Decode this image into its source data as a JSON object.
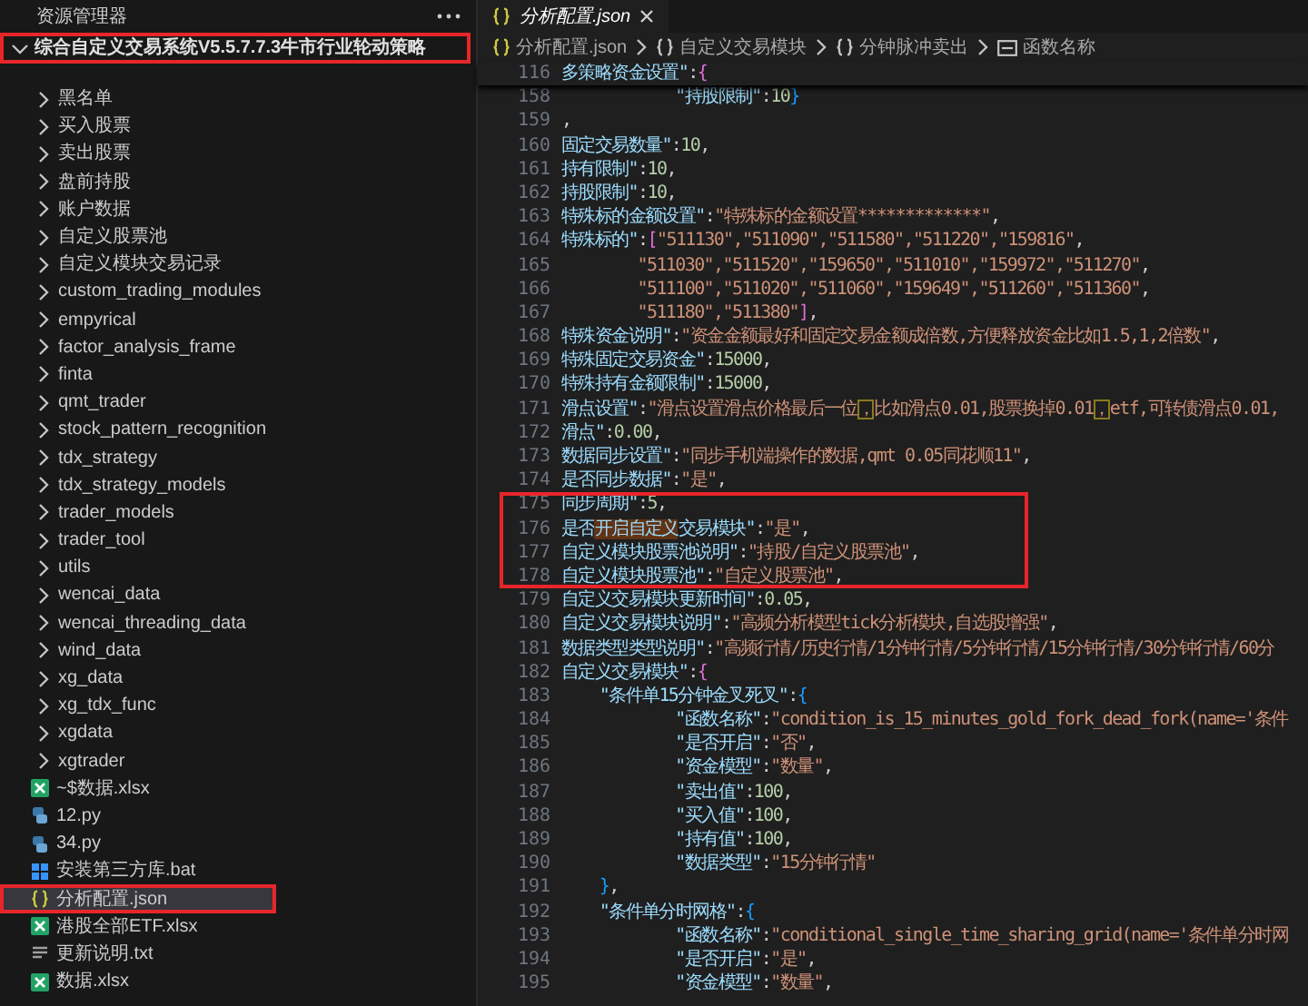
{
  "sidebar": {
    "title": "资源管理器",
    "root": {
      "label": "综合自定义交易系统V5.5.7.7.3牛市行业轮动策略",
      "expanded": true,
      "highlighted": true
    },
    "items": [
      {
        "kind": "folder",
        "label": "黑名单",
        "expanded": false,
        "selected": false,
        "highlighted": false
      },
      {
        "kind": "folder",
        "label": "买入股票",
        "expanded": false,
        "selected": false,
        "highlighted": false
      },
      {
        "kind": "folder",
        "label": "卖出股票",
        "expanded": false,
        "selected": false,
        "highlighted": false
      },
      {
        "kind": "folder",
        "label": "盘前持股",
        "expanded": false,
        "selected": false,
        "highlighted": false
      },
      {
        "kind": "folder",
        "label": "账户数据",
        "expanded": false,
        "selected": false,
        "highlighted": false
      },
      {
        "kind": "folder",
        "label": "自定义股票池",
        "expanded": false,
        "selected": false,
        "highlighted": false
      },
      {
        "kind": "folder",
        "label": "自定义模块交易记录",
        "expanded": false,
        "selected": false,
        "highlighted": false
      },
      {
        "kind": "folder",
        "label": "custom_trading_modules",
        "expanded": false,
        "selected": false,
        "highlighted": false
      },
      {
        "kind": "folder",
        "label": "empyrical",
        "expanded": false,
        "selected": false,
        "highlighted": false
      },
      {
        "kind": "folder",
        "label": "factor_analysis_frame",
        "expanded": false,
        "selected": false,
        "highlighted": false
      },
      {
        "kind": "folder",
        "label": "finta",
        "expanded": false,
        "selected": false,
        "highlighted": false
      },
      {
        "kind": "folder",
        "label": "qmt_trader",
        "expanded": false,
        "selected": false,
        "highlighted": false
      },
      {
        "kind": "folder",
        "label": "stock_pattern_recognition",
        "expanded": false,
        "selected": false,
        "highlighted": false
      },
      {
        "kind": "folder",
        "label": "tdx_strategy",
        "expanded": false,
        "selected": false,
        "highlighted": false
      },
      {
        "kind": "folder",
        "label": "tdx_strategy_models",
        "expanded": false,
        "selected": false,
        "highlighted": false
      },
      {
        "kind": "folder",
        "label": "trader_models",
        "expanded": false,
        "selected": false,
        "highlighted": false
      },
      {
        "kind": "folder",
        "label": "trader_tool",
        "expanded": false,
        "selected": false,
        "highlighted": false
      },
      {
        "kind": "folder",
        "label": "utils",
        "expanded": false,
        "selected": false,
        "highlighted": false
      },
      {
        "kind": "folder",
        "label": "wencai_data",
        "expanded": false,
        "selected": false,
        "highlighted": false
      },
      {
        "kind": "folder",
        "label": "wencai_threading_data",
        "expanded": false,
        "selected": false,
        "highlighted": false
      },
      {
        "kind": "folder",
        "label": "wind_data",
        "expanded": false,
        "selected": false,
        "highlighted": false
      },
      {
        "kind": "folder",
        "label": "xg_data",
        "expanded": false,
        "selected": false,
        "highlighted": false
      },
      {
        "kind": "folder",
        "label": "xg_tdx_func",
        "expanded": false,
        "selected": false,
        "highlighted": false
      },
      {
        "kind": "folder",
        "label": "xgdata",
        "expanded": false,
        "selected": false,
        "highlighted": false
      },
      {
        "kind": "folder",
        "label": "xgtrader",
        "expanded": false,
        "selected": false,
        "highlighted": false
      },
      {
        "kind": "excel",
        "label": "~$数据.xlsx",
        "selected": false,
        "highlighted": false
      },
      {
        "kind": "python",
        "label": "12.py",
        "selected": false,
        "highlighted": false
      },
      {
        "kind": "python",
        "label": "34.py",
        "selected": false,
        "highlighted": false
      },
      {
        "kind": "batch",
        "label": "安装第三方库.bat",
        "selected": false,
        "highlighted": false
      },
      {
        "kind": "json",
        "label": "分析配置.json",
        "selected": true,
        "highlighted": true
      },
      {
        "kind": "excel",
        "label": "港股全部ETF.xlsx",
        "selected": false,
        "highlighted": false
      },
      {
        "kind": "text",
        "label": "更新说明.txt",
        "selected": false,
        "highlighted": false
      },
      {
        "kind": "excel",
        "label": "数据.xlsx",
        "selected": false,
        "highlighted": false
      }
    ]
  },
  "editor": {
    "tab": {
      "label": "分析配置.json",
      "selected": true
    },
    "breadcrumb": [
      {
        "kind": "file",
        "label": "分析配置.json"
      },
      {
        "kind": "object",
        "label": "自定义交易模块"
      },
      {
        "kind": "object",
        "label": "分钟脉冲卖出"
      },
      {
        "kind": "field",
        "label": "函数名称"
      }
    ],
    "sticky_line": {
      "number": "116",
      "tokens": [
        {
          "kind": "key",
          "text": "多策略资金设置\""
        },
        {
          "kind": "punct",
          "text": ":"
        },
        {
          "kind": "bracket1",
          "text": "{"
        }
      ]
    },
    "lines": [
      {
        "number": "158",
        "highlighted": false,
        "tokens": [
          {
            "kind": "key",
            "text": "            \"持股限制\""
          },
          {
            "kind": "punct",
            "text": ":"
          },
          {
            "kind": "number",
            "text": "10"
          },
          {
            "kind": "bracket2",
            "text": "}"
          }
        ]
      },
      {
        "number": "159",
        "highlighted": false,
        "tokens": [
          {
            "kind": "punct",
            "text": ","
          }
        ]
      },
      {
        "number": "160",
        "highlighted": false,
        "tokens": [
          {
            "kind": "key",
            "text": "固定交易数量\""
          },
          {
            "kind": "punct",
            "text": ":"
          },
          {
            "kind": "number",
            "text": "10"
          },
          {
            "kind": "punct",
            "text": ","
          }
        ]
      },
      {
        "number": "161",
        "highlighted": false,
        "tokens": [
          {
            "kind": "key",
            "text": "持有限制\""
          },
          {
            "kind": "punct",
            "text": ":"
          },
          {
            "kind": "number",
            "text": "10"
          },
          {
            "kind": "punct",
            "text": ","
          }
        ]
      },
      {
        "number": "162",
        "highlighted": false,
        "tokens": [
          {
            "kind": "key",
            "text": "持股限制\""
          },
          {
            "kind": "punct",
            "text": ":"
          },
          {
            "kind": "number",
            "text": "10"
          },
          {
            "kind": "punct",
            "text": ","
          }
        ]
      },
      {
        "number": "163",
        "highlighted": false,
        "tokens": [
          {
            "kind": "key",
            "text": "特殊标的金额设置\""
          },
          {
            "kind": "punct",
            "text": ":"
          },
          {
            "kind": "string",
            "text": "\"特殊标的金额设置*************\""
          },
          {
            "kind": "punct",
            "text": ","
          }
        ]
      },
      {
        "number": "164",
        "highlighted": false,
        "tokens": [
          {
            "kind": "key",
            "text": "特殊标的\""
          },
          {
            "kind": "punct",
            "text": ":"
          },
          {
            "kind": "bracket1",
            "text": "["
          },
          {
            "kind": "string",
            "text": "\"511130\",\"511090\",\"511580\",\"511220\",\"159816\""
          },
          {
            "kind": "punct",
            "text": ","
          }
        ]
      },
      {
        "number": "165",
        "highlighted": false,
        "tokens": [
          {
            "kind": "string",
            "text": "        \"511030\",\"511520\",\"159650\",\"511010\",\"159972\",\"511270\""
          },
          {
            "kind": "punct",
            "text": ","
          }
        ]
      },
      {
        "number": "166",
        "highlighted": false,
        "tokens": [
          {
            "kind": "string",
            "text": "        \"511100\",\"511020\",\"511060\",\"159649\",\"511260\",\"511360\""
          },
          {
            "kind": "punct",
            "text": ","
          }
        ]
      },
      {
        "number": "167",
        "highlighted": false,
        "tokens": [
          {
            "kind": "string",
            "text": "        \"511180\",\"511380\""
          },
          {
            "kind": "bracket1",
            "text": "]"
          },
          {
            "kind": "punct",
            "text": ","
          }
        ]
      },
      {
        "number": "168",
        "highlighted": false,
        "tokens": [
          {
            "kind": "key",
            "text": "特殊资金说明\""
          },
          {
            "kind": "punct",
            "text": ":"
          },
          {
            "kind": "string",
            "text": "\"资金金额最好和固定交易金额成倍数,方便释放资金比如1.5,1,2倍数\""
          },
          {
            "kind": "punct",
            "text": ","
          }
        ]
      },
      {
        "number": "169",
        "highlighted": false,
        "tokens": [
          {
            "kind": "key",
            "text": "特殊固定交易资金\""
          },
          {
            "kind": "punct",
            "text": ":"
          },
          {
            "kind": "number",
            "text": "15000"
          },
          {
            "kind": "punct",
            "text": ","
          }
        ]
      },
      {
        "number": "170",
        "highlighted": false,
        "tokens": [
          {
            "kind": "key",
            "text": "特殊持有金额限制\""
          },
          {
            "kind": "punct",
            "text": ":"
          },
          {
            "kind": "number",
            "text": "15000"
          },
          {
            "kind": "punct",
            "text": ","
          }
        ]
      },
      {
        "number": "171",
        "highlighted": false,
        "tokens": [
          {
            "kind": "key",
            "text": "滑点设置\""
          },
          {
            "kind": "punct",
            "text": ":"
          },
          {
            "kind": "string",
            "text": "\"滑点设置滑点价格最后一位"
          },
          {
            "kind": "flagged",
            "text": "，"
          },
          {
            "kind": "string",
            "text": "比如滑点0.01,股票换掉0.01"
          },
          {
            "kind": "flagged",
            "text": "，"
          },
          {
            "kind": "string",
            "text": "etf,可转债滑点0.01,"
          }
        ]
      },
      {
        "number": "172",
        "highlighted": false,
        "tokens": [
          {
            "kind": "key",
            "text": "滑点\""
          },
          {
            "kind": "punct",
            "text": ":"
          },
          {
            "kind": "number",
            "text": "0.00"
          },
          {
            "kind": "punct",
            "text": ","
          }
        ]
      },
      {
        "number": "173",
        "highlighted": false,
        "tokens": [
          {
            "kind": "key",
            "text": "数据同步设置\""
          },
          {
            "kind": "punct",
            "text": ":"
          },
          {
            "kind": "string",
            "text": "\"同步手机端操作的数据,qmt 0.05同花顺11\""
          },
          {
            "kind": "punct",
            "text": ","
          }
        ]
      },
      {
        "number": "174",
        "highlighted": false,
        "tokens": [
          {
            "kind": "key",
            "text": "是否同步数据\""
          },
          {
            "kind": "punct",
            "text": ":"
          },
          {
            "kind": "string",
            "text": "\"是\""
          },
          {
            "kind": "punct",
            "text": ","
          }
        ]
      },
      {
        "number": "175",
        "highlighted": true,
        "tokens": [
          {
            "kind": "key",
            "text": "同步周期\""
          },
          {
            "kind": "punct",
            "text": ":"
          },
          {
            "kind": "number",
            "text": "5"
          },
          {
            "kind": "punct",
            "text": ","
          }
        ]
      },
      {
        "number": "176",
        "highlighted": true,
        "tokens": [
          {
            "kind": "key",
            "text": "是否"
          },
          {
            "kind": "match",
            "text": "开启自定义"
          },
          {
            "kind": "key",
            "text": "交易模块\""
          },
          {
            "kind": "punct",
            "text": ":"
          },
          {
            "kind": "string",
            "text": "\"是\""
          },
          {
            "kind": "punct",
            "text": ","
          }
        ]
      },
      {
        "number": "177",
        "highlighted": true,
        "tokens": [
          {
            "kind": "key",
            "text": "自定义模块股票池说明\""
          },
          {
            "kind": "punct",
            "text": ":"
          },
          {
            "kind": "string",
            "text": "\"持股/自定义股票池\""
          },
          {
            "kind": "punct",
            "text": ","
          }
        ]
      },
      {
        "number": "178",
        "highlighted": true,
        "tokens": [
          {
            "kind": "key",
            "text": "自定义模块股票池\""
          },
          {
            "kind": "punct",
            "text": ":"
          },
          {
            "kind": "string",
            "text": "\"自定义股票池\""
          },
          {
            "kind": "punct",
            "text": ","
          }
        ]
      },
      {
        "number": "179",
        "highlighted": false,
        "tokens": [
          {
            "kind": "key",
            "text": "自定义交易模块更新时间\""
          },
          {
            "kind": "punct",
            "text": ":"
          },
          {
            "kind": "number",
            "text": "0.05"
          },
          {
            "kind": "punct",
            "text": ","
          }
        ]
      },
      {
        "number": "180",
        "highlighted": false,
        "tokens": [
          {
            "kind": "key",
            "text": "自定义交易模块说明\""
          },
          {
            "kind": "punct",
            "text": ":"
          },
          {
            "kind": "string",
            "text": "\"高频分析模型tick分析模块,自选股增强\""
          },
          {
            "kind": "punct",
            "text": ","
          }
        ]
      },
      {
        "number": "181",
        "highlighted": false,
        "tokens": [
          {
            "kind": "key",
            "text": "数据类型类型说明\""
          },
          {
            "kind": "punct",
            "text": ":"
          },
          {
            "kind": "string",
            "text": "\"高频行情/历史行情/1分钟行情/5分钟行情/15分钟行情/30分钟行情/60分"
          }
        ]
      },
      {
        "number": "182",
        "highlighted": false,
        "tokens": [
          {
            "kind": "key",
            "text": "自定义交易模块\""
          },
          {
            "kind": "punct",
            "text": ":"
          },
          {
            "kind": "bracket1",
            "text": "{"
          }
        ]
      },
      {
        "number": "183",
        "highlighted": false,
        "tokens": [
          {
            "kind": "key",
            "text": "    \"条件单15分钟金叉死叉\""
          },
          {
            "kind": "punct",
            "text": ":"
          },
          {
            "kind": "bracket2",
            "text": "{"
          }
        ]
      },
      {
        "number": "184",
        "highlighted": false,
        "tokens": [
          {
            "kind": "key",
            "text": "            \"函数名称\""
          },
          {
            "kind": "punct",
            "text": ":"
          },
          {
            "kind": "string",
            "text": "\"condition_is_15_minutes_gold_fork_dead_fork(name='条件"
          }
        ]
      },
      {
        "number": "185",
        "highlighted": false,
        "tokens": [
          {
            "kind": "key",
            "text": "            \"是否开启\""
          },
          {
            "kind": "punct",
            "text": ":"
          },
          {
            "kind": "string",
            "text": "\"否\""
          },
          {
            "kind": "punct",
            "text": ","
          }
        ]
      },
      {
        "number": "186",
        "highlighted": false,
        "tokens": [
          {
            "kind": "key",
            "text": "            \"资金模型\""
          },
          {
            "kind": "punct",
            "text": ":"
          },
          {
            "kind": "string",
            "text": "\"数量\""
          },
          {
            "kind": "punct",
            "text": ","
          }
        ]
      },
      {
        "number": "187",
        "highlighted": false,
        "tokens": [
          {
            "kind": "key",
            "text": "            \"卖出值\""
          },
          {
            "kind": "punct",
            "text": ":"
          },
          {
            "kind": "number",
            "text": "100"
          },
          {
            "kind": "punct",
            "text": ","
          }
        ]
      },
      {
        "number": "188",
        "highlighted": false,
        "tokens": [
          {
            "kind": "key",
            "text": "            \"买入值\""
          },
          {
            "kind": "punct",
            "text": ":"
          },
          {
            "kind": "number",
            "text": "100"
          },
          {
            "kind": "punct",
            "text": ","
          }
        ]
      },
      {
        "number": "189",
        "highlighted": false,
        "tokens": [
          {
            "kind": "key",
            "text": "            \"持有值\""
          },
          {
            "kind": "punct",
            "text": ":"
          },
          {
            "kind": "number",
            "text": "100"
          },
          {
            "kind": "punct",
            "text": ","
          }
        ]
      },
      {
        "number": "190",
        "highlighted": false,
        "tokens": [
          {
            "kind": "key",
            "text": "            \"数据类型\""
          },
          {
            "kind": "punct",
            "text": ":"
          },
          {
            "kind": "string",
            "text": "\"15分钟行情\""
          }
        ]
      },
      {
        "number": "191",
        "highlighted": false,
        "tokens": [
          {
            "kind": "bracket2",
            "text": "    }"
          },
          {
            "kind": "punct",
            "text": ","
          }
        ]
      },
      {
        "number": "192",
        "highlighted": false,
        "tokens": [
          {
            "kind": "key",
            "text": "    \"条件单分时网格\""
          },
          {
            "kind": "punct",
            "text": ":"
          },
          {
            "kind": "bracket2",
            "text": "{"
          }
        ]
      },
      {
        "number": "193",
        "highlighted": false,
        "tokens": [
          {
            "kind": "key",
            "text": "            \"函数名称\""
          },
          {
            "kind": "punct",
            "text": ":"
          },
          {
            "kind": "string",
            "text": "\"conditional_single_time_sharing_grid(name='条件单分时网"
          }
        ]
      },
      {
        "number": "194",
        "highlighted": false,
        "tokens": [
          {
            "kind": "key",
            "text": "            \"是否开启\""
          },
          {
            "kind": "punct",
            "text": ":"
          },
          {
            "kind": "string",
            "text": "\"是\""
          },
          {
            "kind": "punct",
            "text": ","
          }
        ]
      },
      {
        "number": "195",
        "highlighted": false,
        "tokens": [
          {
            "kind": "key",
            "text": "            \"资金模型\""
          },
          {
            "kind": "punct",
            "text": ":"
          },
          {
            "kind": "string",
            "text": "\"数量\""
          },
          {
            "kind": "punct",
            "text": ","
          }
        ]
      }
    ]
  }
}
